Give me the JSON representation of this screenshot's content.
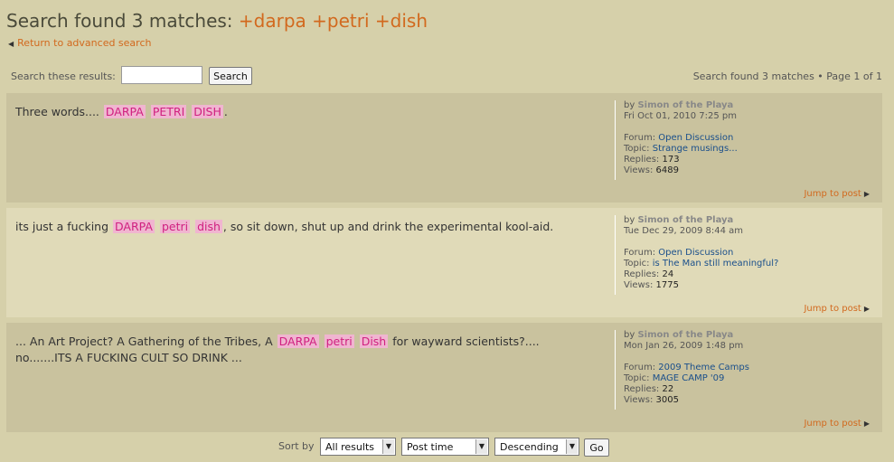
{
  "header": {
    "title_prefix": "Search found 3 matches: ",
    "title_terms": "+darpa +petri +dish",
    "return_link": "Return to advanced search"
  },
  "search": {
    "label": "Search these results:",
    "input_value": "",
    "button": "Search",
    "summary": "Search found 3 matches • Page 1 of 1"
  },
  "posts": [
    {
      "body": [
        {
          "t": "Three words.... "
        },
        {
          "t": "DARPA",
          "hl": true
        },
        {
          "t": " "
        },
        {
          "t": "PETRI",
          "hl": true
        },
        {
          "t": " "
        },
        {
          "t": "DISH",
          "hl": true
        },
        {
          "t": "."
        }
      ],
      "by_label": "by",
      "author": "Simon of the Playa",
      "date": "Fri Oct 01, 2010 7:25 pm",
      "forum_label": "Forum:",
      "forum": "Open Discussion",
      "topic_label": "Topic:",
      "topic": "Strange musings...",
      "replies_label": "Replies:",
      "replies": "173",
      "views_label": "Views:",
      "views": "6489",
      "jump": "Jump to post"
    },
    {
      "body": [
        {
          "t": "its just a fucking "
        },
        {
          "t": "DARPA",
          "hl": true
        },
        {
          "t": " "
        },
        {
          "t": "petri",
          "hl": true
        },
        {
          "t": " "
        },
        {
          "t": "dish",
          "hl": true
        },
        {
          "t": ", so sit down, shut up and drink the experimental kool-aid."
        }
      ],
      "by_label": "by",
      "author": "Simon of the Playa",
      "date": "Tue Dec 29, 2009 8:44 am",
      "forum_label": "Forum:",
      "forum": "Open Discussion",
      "topic_label": "Topic:",
      "topic": "is The Man still meaningful?",
      "replies_label": "Replies:",
      "replies": "24",
      "views_label": "Views:",
      "views": "1775",
      "jump": "Jump to post"
    },
    {
      "body": [
        {
          "t": "... An Art Project? A Gathering of the Tribes, A "
        },
        {
          "t": "DARPA",
          "hl": true
        },
        {
          "t": " "
        },
        {
          "t": "petri",
          "hl": true
        },
        {
          "t": " "
        },
        {
          "t": "Dish",
          "hl": true
        },
        {
          "t": " for wayward scientists?.... no.......ITS A FUCKING CULT SO DRINK ..."
        }
      ],
      "by_label": "by",
      "author": "Simon of the Playa",
      "date": "Mon Jan 26, 2009 1:48 pm",
      "forum_label": "Forum:",
      "forum": "2009 Theme Camps",
      "topic_label": "Topic:",
      "topic": "MAGE CAMP '09",
      "replies_label": "Replies:",
      "replies": "22",
      "views_label": "Views:",
      "views": "3005",
      "jump": "Jump to post"
    }
  ],
  "sort": {
    "label": "Sort by",
    "results": "All results",
    "field": "Post time",
    "direction": "Descending",
    "go": "Go"
  },
  "icons": {
    "return_arrow": "left-arrow-icon",
    "jump_arrow": "right-arrow-icon",
    "dropdown": "chevron-down-icon"
  },
  "colors": {
    "page_bg": "#d6d0aa",
    "post_bg_dark": "#c9c29e",
    "post_bg_light": "#e0dab8",
    "accent_orange": "#d2691e",
    "link_blue": "#1a4f8b",
    "highlight_bg": "#f0b5d0",
    "highlight_text": "#d02080"
  }
}
